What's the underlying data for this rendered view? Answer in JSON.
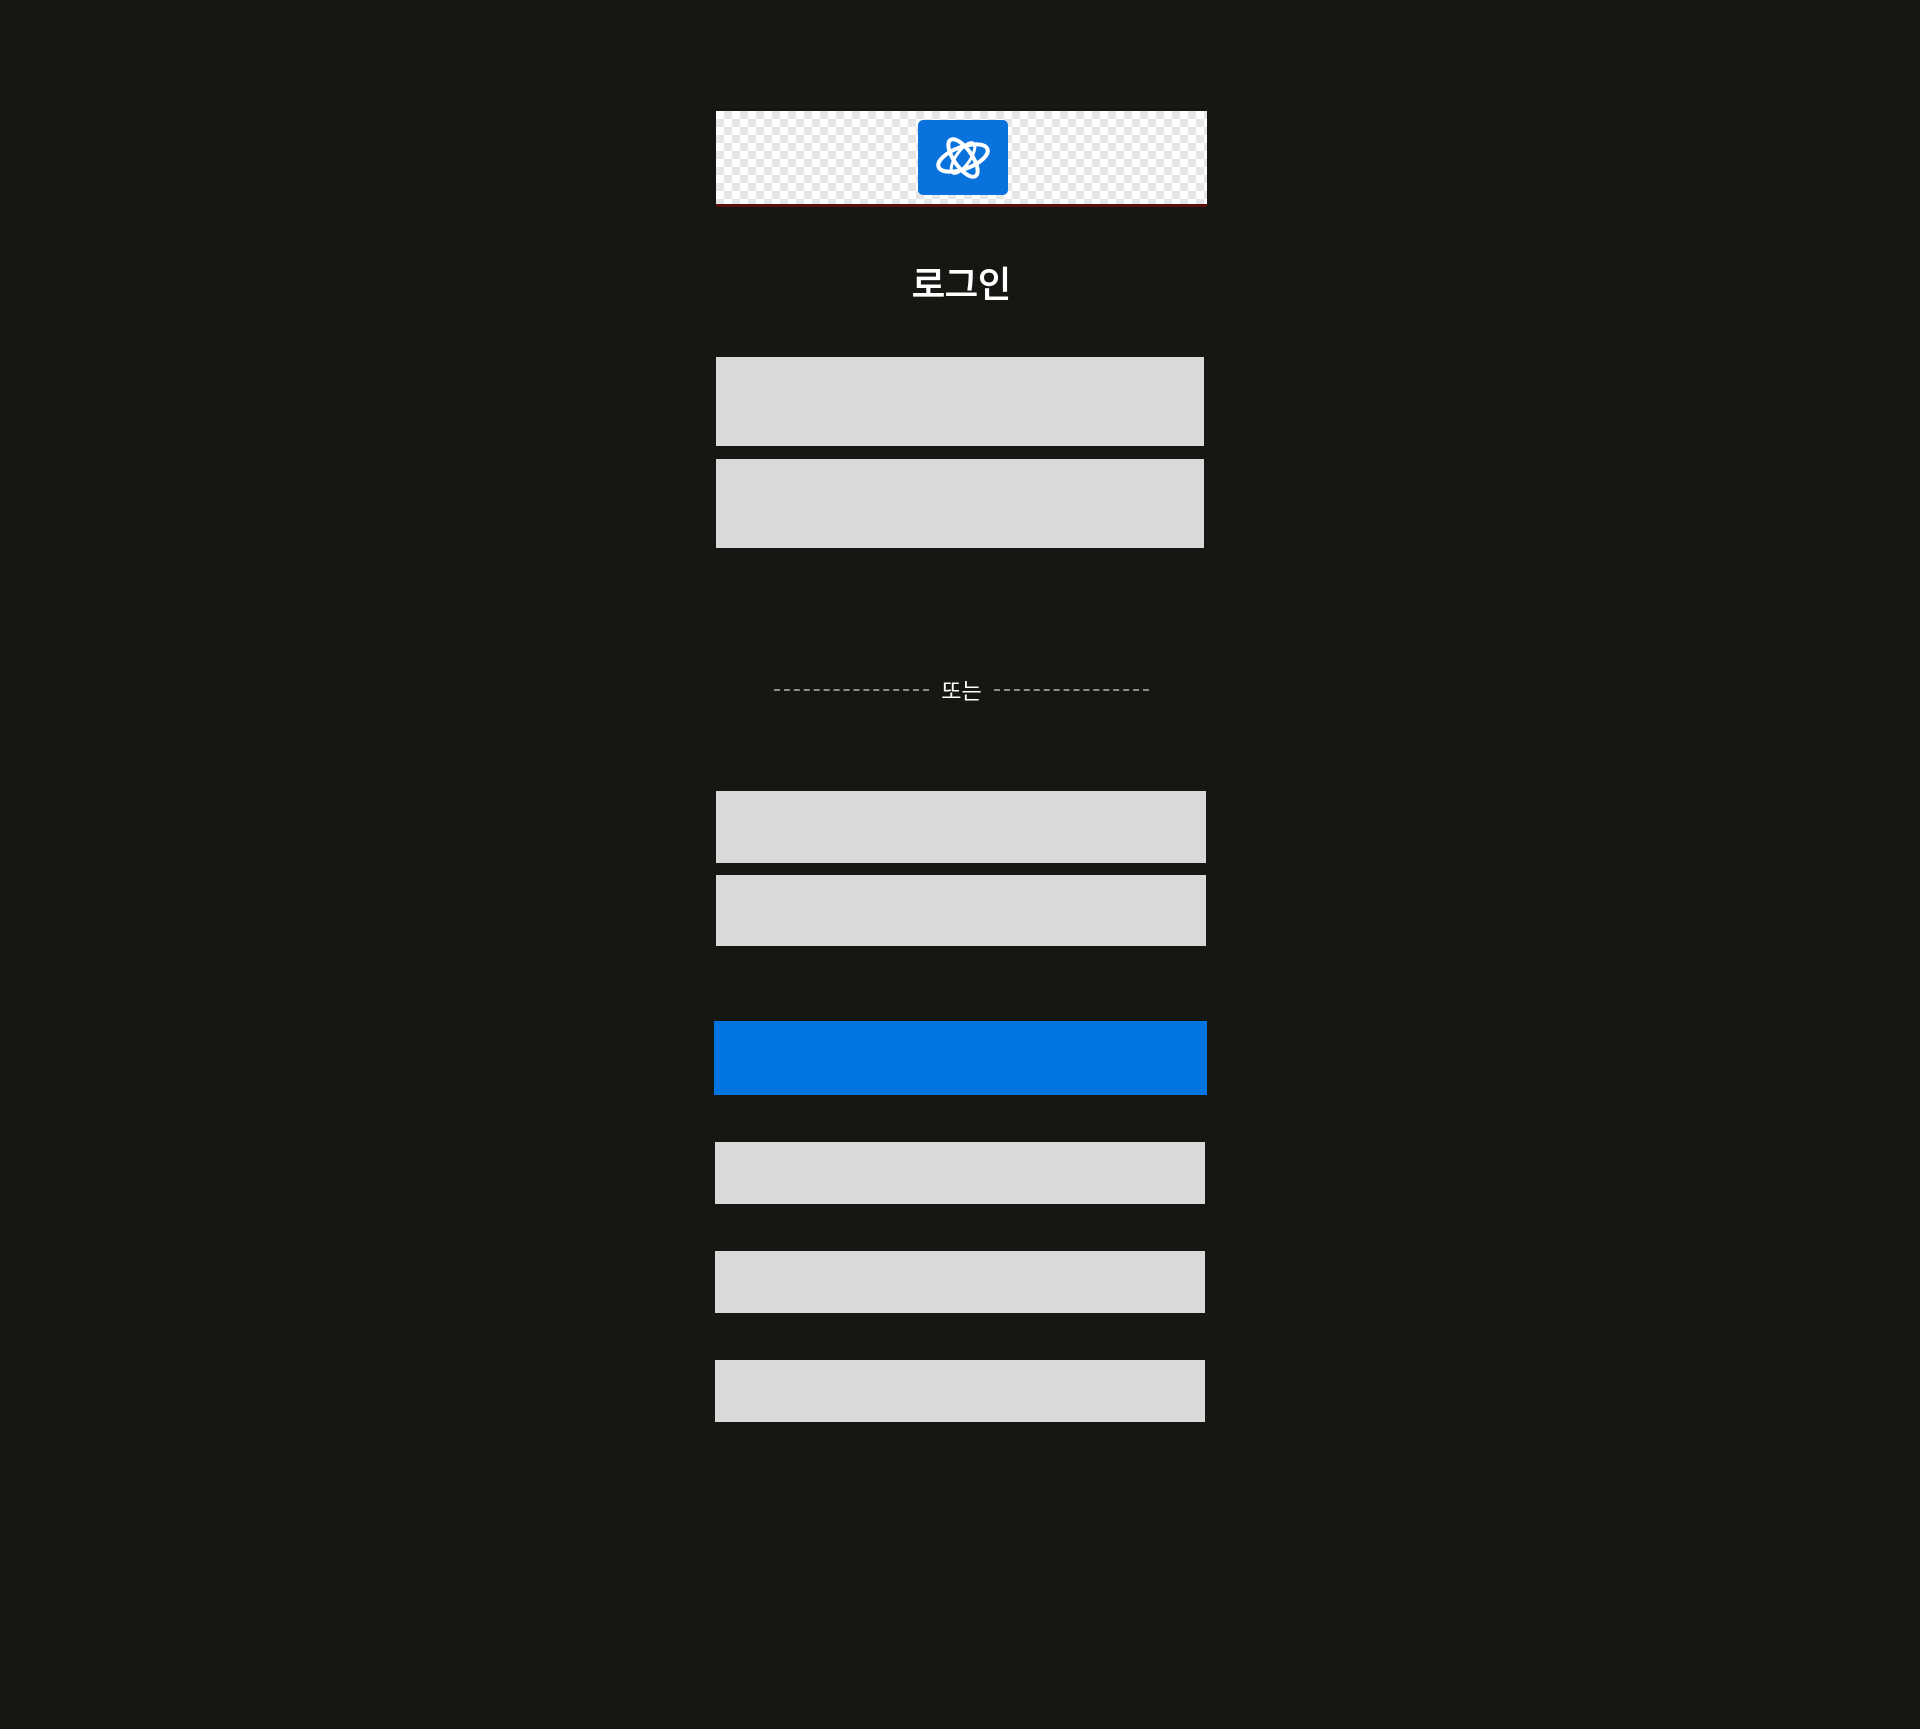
{
  "colors": {
    "background": "#151713",
    "field": "#d9d9d9",
    "primary": "#0074e0",
    "title_text": "#ffffff"
  },
  "header": {
    "logo_icon": "battle-net-logo-icon"
  },
  "login": {
    "title": "로그인"
  },
  "divider": {
    "text": "또는"
  },
  "sections": {
    "top_fields": [
      {
        "name": "field-1",
        "value": ""
      },
      {
        "name": "field-2",
        "value": ""
      }
    ],
    "bottom_fields": [
      {
        "name": "field-3",
        "value": ""
      },
      {
        "name": "field-4",
        "value": ""
      }
    ],
    "primary_button": {
      "label": ""
    },
    "secondary_buttons": [
      {
        "label": ""
      },
      {
        "label": ""
      },
      {
        "label": ""
      }
    ]
  }
}
